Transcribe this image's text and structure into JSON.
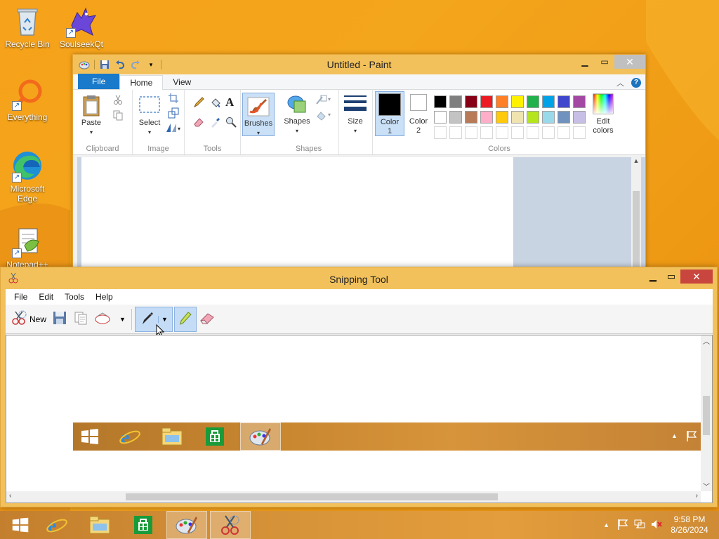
{
  "desktop": {
    "icons": [
      {
        "label": "Recycle Bin"
      },
      {
        "label": "SoulseekQt"
      },
      {
        "label": "Everything"
      },
      {
        "label": "Microsoft Edge"
      },
      {
        "label": "Notepad++"
      }
    ]
  },
  "paint": {
    "title": "Untitled - Paint",
    "tabs": {
      "file": "File",
      "home": "Home",
      "view": "View"
    },
    "ribbon": {
      "clipboard": {
        "paste": "Paste",
        "group": "Clipboard"
      },
      "image": {
        "select": "Select",
        "group": "Image"
      },
      "tools": {
        "group": "Tools"
      },
      "brushes": {
        "label": "Brushes"
      },
      "shapes": {
        "label": "Shapes",
        "group": "Shapes"
      },
      "size": {
        "label": "Size"
      },
      "color1": {
        "line1": "Color",
        "line2": "1"
      },
      "color2": {
        "line1": "Color",
        "line2": "2"
      },
      "edit_colors": {
        "line1": "Edit",
        "line2": "colors"
      },
      "colors_group": "Colors"
    },
    "palette_row1": [
      "#000000",
      "#7f7f7f",
      "#880015",
      "#ed1c24",
      "#ff7f27",
      "#fff200",
      "#22b14c",
      "#00a2e8",
      "#3f48cc",
      "#a349a4"
    ],
    "palette_row2": [
      "#ffffff",
      "#c3c3c3",
      "#b97a57",
      "#ffaec9",
      "#ffc90e",
      "#efe4b0",
      "#b5e61d",
      "#99d9ea",
      "#7092be",
      "#c8bfe7"
    ]
  },
  "snipping": {
    "title": "Snipping Tool",
    "menu": {
      "file": "File",
      "edit": "Edit",
      "tools": "Tools",
      "help": "Help"
    },
    "toolbar": {
      "new": "New"
    }
  },
  "taskbar": {
    "time": "9:58 PM",
    "date": "8/26/2024"
  }
}
